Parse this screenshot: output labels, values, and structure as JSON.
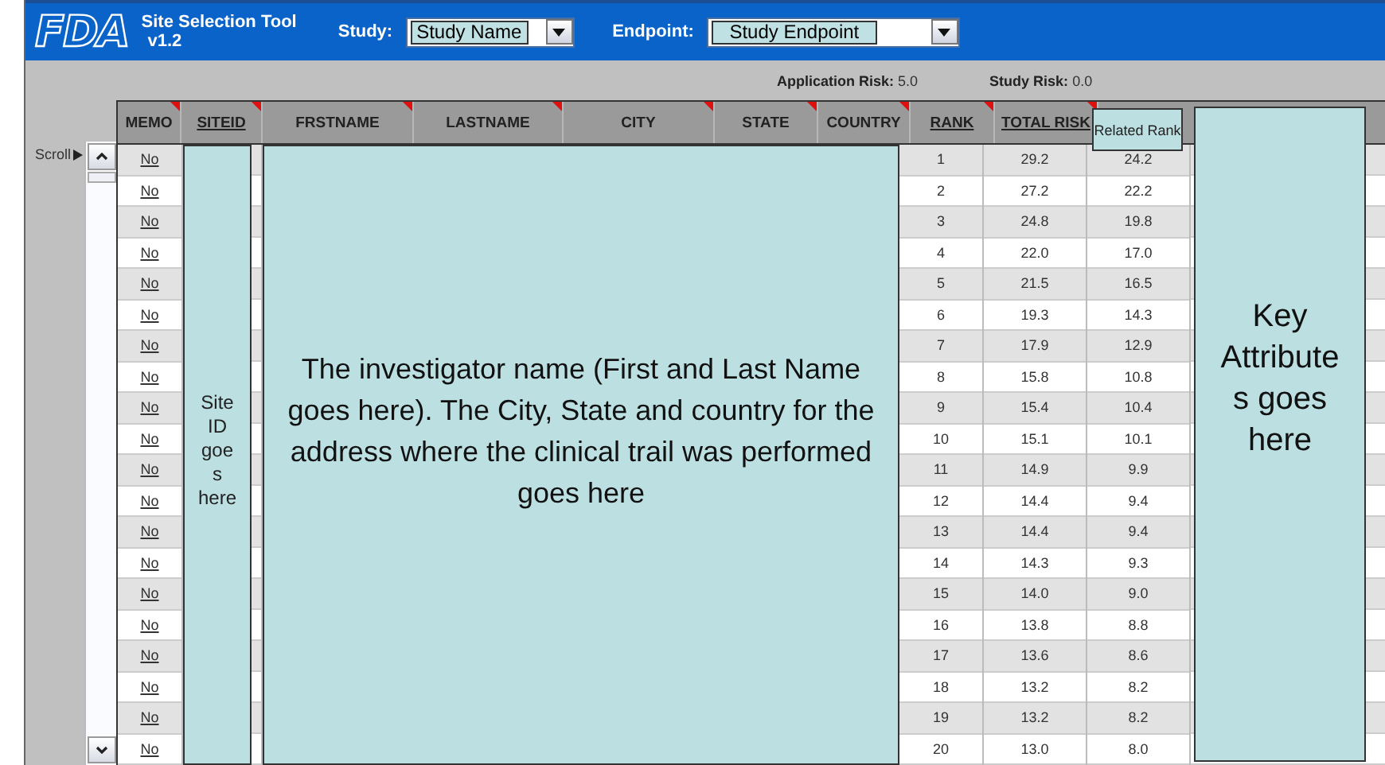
{
  "app": {
    "logo": "FDA",
    "title": "Site Selection Tool",
    "version": "v1.2"
  },
  "study": {
    "label": "Study:",
    "value": "Study Name"
  },
  "endpoint": {
    "label": "Endpoint:",
    "value": "Study Endpoint"
  },
  "risks": [
    {
      "label": "Application Risk:",
      "value": "5.0"
    },
    {
      "label": "Study Risk:",
      "value": "0.0"
    }
  ],
  "scroll_label": "Scroll",
  "columns": [
    {
      "label": "MEMO",
      "underlined": false,
      "flagged": true
    },
    {
      "label": "SITEID",
      "underlined": true,
      "flagged": true
    },
    {
      "label": "FRSTNAME",
      "underlined": false,
      "flagged": true
    },
    {
      "label": "LASTNAME",
      "underlined": false,
      "flagged": true
    },
    {
      "label": "CITY",
      "underlined": false,
      "flagged": true
    },
    {
      "label": "STATE",
      "underlined": false,
      "flagged": true
    },
    {
      "label": "COUNTRY",
      "underlined": false,
      "flagged": true
    },
    {
      "label": "RANK",
      "underlined": true,
      "flagged": true
    },
    {
      "label": "TOTAL RISK",
      "underlined": true,
      "flagged": true
    }
  ],
  "related_rank_label": "Related Rank",
  "site_id_note": "Site ID goes here",
  "name_note": "The investigator name (First and Last Name goes here). The City, State and country for the address where the clinical trail was performed goes here",
  "key_attributes_note": "Key Attributes goes here",
  "rows": [
    {
      "memo": "No",
      "rank": "1",
      "total_risk": "29.2",
      "related_rank": "24.2"
    },
    {
      "memo": "No",
      "rank": "2",
      "total_risk": "27.2",
      "related_rank": "22.2"
    },
    {
      "memo": "No",
      "rank": "3",
      "total_risk": "24.8",
      "related_rank": "19.8"
    },
    {
      "memo": "No",
      "rank": "4",
      "total_risk": "22.0",
      "related_rank": "17.0"
    },
    {
      "memo": "No",
      "rank": "5",
      "total_risk": "21.5",
      "related_rank": "16.5"
    },
    {
      "memo": "No",
      "rank": "6",
      "total_risk": "19.3",
      "related_rank": "14.3"
    },
    {
      "memo": "No",
      "rank": "7",
      "total_risk": "17.9",
      "related_rank": "12.9"
    },
    {
      "memo": "No",
      "rank": "8",
      "total_risk": "15.8",
      "related_rank": "10.8"
    },
    {
      "memo": "No",
      "rank": "9",
      "total_risk": "15.4",
      "related_rank": "10.4"
    },
    {
      "memo": "No",
      "rank": "10",
      "total_risk": "15.1",
      "related_rank": "10.1"
    },
    {
      "memo": "No",
      "rank": "11",
      "total_risk": "14.9",
      "related_rank": "9.9"
    },
    {
      "memo": "No",
      "rank": "12",
      "total_risk": "14.4",
      "related_rank": "9.4"
    },
    {
      "memo": "No",
      "rank": "13",
      "total_risk": "14.4",
      "related_rank": "9.4"
    },
    {
      "memo": "No",
      "rank": "14",
      "total_risk": "14.3",
      "related_rank": "9.3"
    },
    {
      "memo": "No",
      "rank": "15",
      "total_risk": "14.0",
      "related_rank": "9.0"
    },
    {
      "memo": "No",
      "rank": "16",
      "total_risk": "13.8",
      "related_rank": "8.8"
    },
    {
      "memo": "No",
      "rank": "17",
      "total_risk": "13.6",
      "related_rank": "8.6"
    },
    {
      "memo": "No",
      "rank": "18",
      "total_risk": "13.2",
      "related_rank": "8.2"
    },
    {
      "memo": "No",
      "rank": "19",
      "total_risk": "13.2",
      "related_rank": "8.2"
    },
    {
      "memo": "No",
      "rank": "20",
      "total_risk": "13.0",
      "related_rank": "8.0"
    }
  ]
}
